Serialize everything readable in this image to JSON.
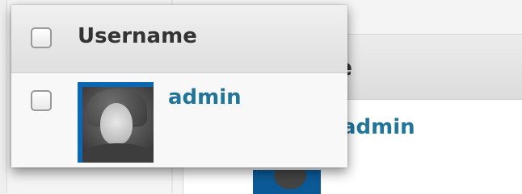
{
  "background_table": {
    "header_fragment": "e",
    "username_link": "admin"
  },
  "zoom": {
    "column_header": "Username",
    "rows": [
      {
        "username": "admin",
        "avatar": "user-photo"
      }
    ]
  },
  "colors": {
    "link": "#21759b",
    "avatar_border": "#0b67b0",
    "header_bg": "#e4e4e4"
  }
}
